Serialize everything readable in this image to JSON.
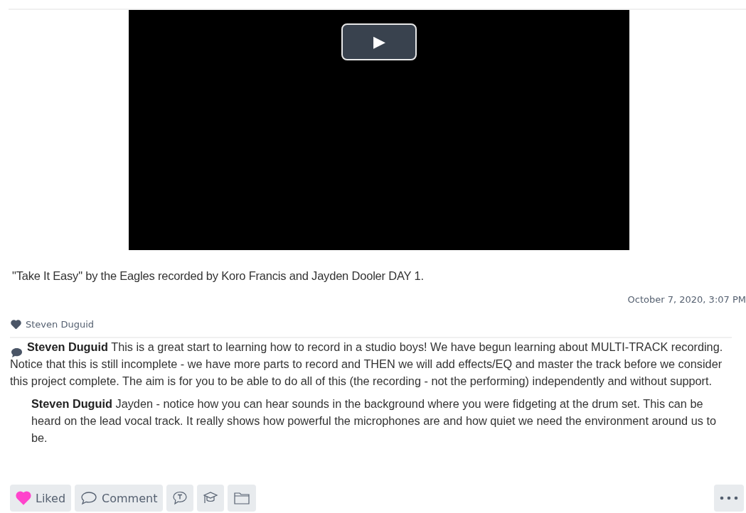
{
  "video": {
    "play_label": "▶"
  },
  "caption": "\"Take It Easy\" by the Eagles recorded by Koro Francis and Jayden Dooler DAY 1.",
  "timestamp": "October 7, 2020, 3:07 PM",
  "likes": [
    "Steven Duguid"
  ],
  "comments": [
    {
      "author": "Steven Duguid",
      "text": "This is a great start to learning how to record in a studio boys! We have begun learning about MULTI-TRACK recording. Notice that this is still incomplete - we have more parts to record and THEN we will add effects/EQ and master the track before we consider this project complete. The aim is for you to be able to do all of this (the recording - not the performing) independently and without support.",
      "kind": "top"
    },
    {
      "author": "Steven Duguid",
      "text": "Jayden - notice how you can hear sounds in the background where you were fidgeting at the drum set. This can be heard on the lead vocal track. It really shows how powerful the microphones are and how quiet we need the environment around us to be.",
      "kind": "reply"
    }
  ],
  "actions": {
    "like": {
      "label": "Liked",
      "liked": true
    },
    "comment": {
      "label": "Comment"
    }
  }
}
